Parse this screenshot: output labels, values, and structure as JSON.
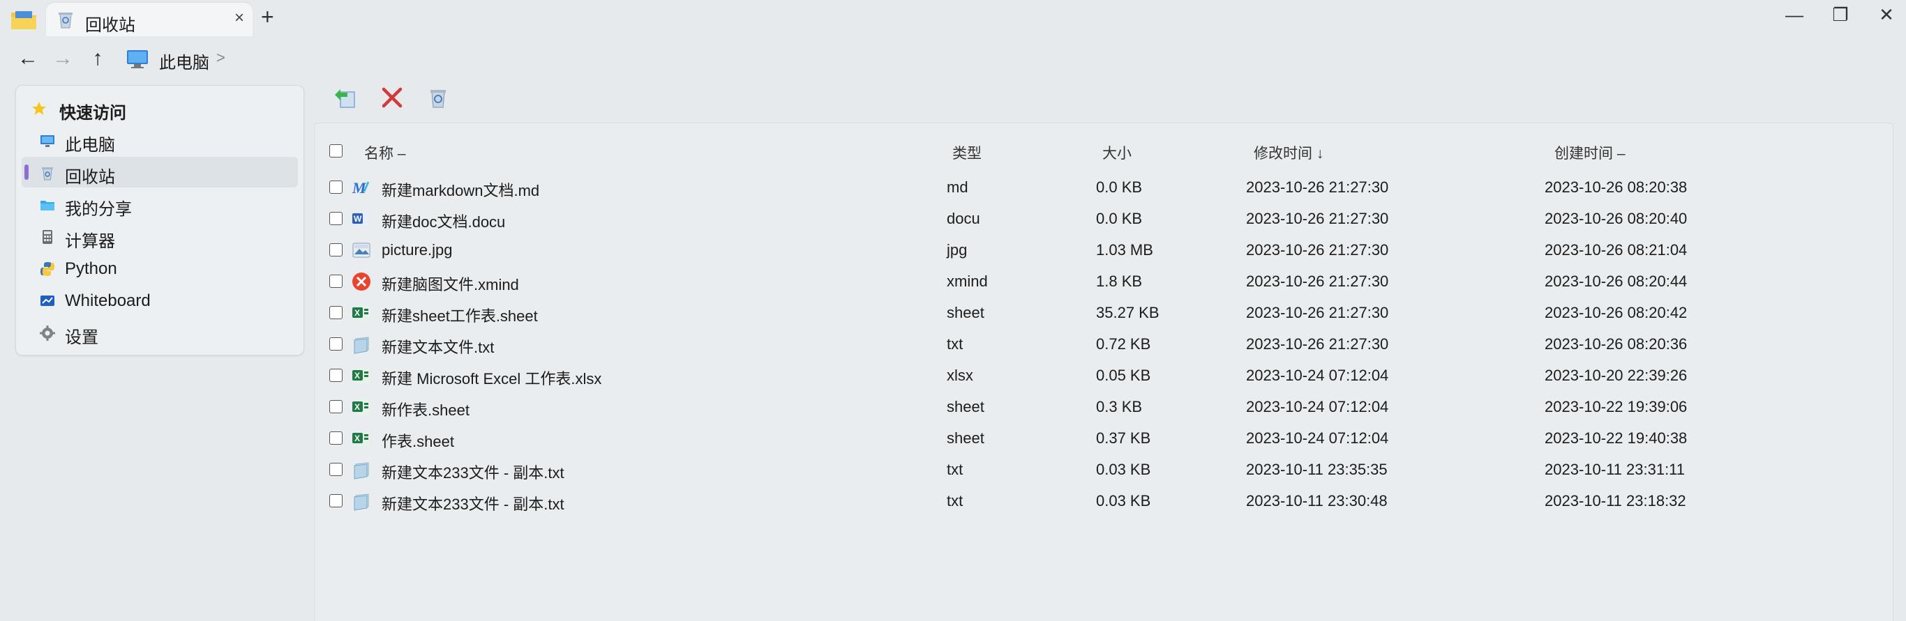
{
  "window": {
    "tab_title": "回收站",
    "new_tab": "+",
    "tab_close": "×",
    "minimize": "—",
    "restore": "❐",
    "close": "✕"
  },
  "nav": {
    "back": "←",
    "forward": "→",
    "up": "↑",
    "breadcrumb": [
      "此电脑"
    ],
    "separator": ">"
  },
  "sidebar": {
    "header": "快速访问",
    "items": [
      {
        "label": "此电脑",
        "icon": "computer-icon",
        "active": false
      },
      {
        "label": "回收站",
        "icon": "recycle-bin-icon",
        "active": true
      },
      {
        "label": "我的分享",
        "icon": "share-folder-icon",
        "active": false
      },
      {
        "label": "计算器",
        "icon": "calculator-icon",
        "active": false
      },
      {
        "label": "Python",
        "icon": "python-icon",
        "active": false
      },
      {
        "label": "Whiteboard",
        "icon": "whiteboard-icon",
        "active": false
      },
      {
        "label": "设置",
        "icon": "gear-icon",
        "active": false
      }
    ]
  },
  "toolbar": {
    "buttons": [
      "restore-icon",
      "delete-icon",
      "empty-bin-icon"
    ]
  },
  "table": {
    "columns": [
      "名称 –",
      "类型",
      "大小",
      "修改时间 ↓",
      "创建时间 –"
    ],
    "rows": [
      {
        "name": "新建markdown文档.md",
        "type": "md",
        "size": "0.0 KB",
        "modified": "2023-10-26 21:27:30",
        "created": "2023-10-26 08:20:38",
        "icon": "markdown-icon"
      },
      {
        "name": "新建doc文档.docu",
        "type": "docu",
        "size": "0.0 KB",
        "modified": "2023-10-26 21:27:30",
        "created": "2023-10-26 08:20:40",
        "icon": "word-icon"
      },
      {
        "name": "picture.jpg",
        "type": "jpg",
        "size": "1.03 MB",
        "modified": "2023-10-26 21:27:30",
        "created": "2023-10-26 08:21:04",
        "icon": "image-icon"
      },
      {
        "name": "新建脑图文件.xmind",
        "type": "xmind",
        "size": "1.8 KB",
        "modified": "2023-10-26 21:27:30",
        "created": "2023-10-26 08:20:44",
        "icon": "xmind-icon"
      },
      {
        "name": "新建sheet工作表.sheet",
        "type": "sheet",
        "size": "35.27 KB",
        "modified": "2023-10-26 21:27:30",
        "created": "2023-10-26 08:20:42",
        "icon": "excel-icon"
      },
      {
        "name": "新建文本文件.txt",
        "type": "txt",
        "size": "0.72 KB",
        "modified": "2023-10-26 21:27:30",
        "created": "2023-10-26 08:20:36",
        "icon": "text-file-icon"
      },
      {
        "name": "新建 Microsoft Excel 工作表.xlsx",
        "type": "xlsx",
        "size": "0.05 KB",
        "modified": "2023-10-24 07:12:04",
        "created": "2023-10-20 22:39:26",
        "icon": "excel-icon"
      },
      {
        "name": "新作表.sheet",
        "type": "sheet",
        "size": "0.3 KB",
        "modified": "2023-10-24 07:12:04",
        "created": "2023-10-22 19:39:06",
        "icon": "excel-icon"
      },
      {
        "name": "作表.sheet",
        "type": "sheet",
        "size": "0.37 KB",
        "modified": "2023-10-24 07:12:04",
        "created": "2023-10-22 19:40:38",
        "icon": "excel-icon"
      },
      {
        "name": "新建文本233文件 - 副本.txt",
        "type": "txt",
        "size": "0.03 KB",
        "modified": "2023-10-11 23:35:35",
        "created": "2023-10-11 23:31:11",
        "icon": "text-file-icon"
      },
      {
        "name": "新建文本233文件 - 副本.txt",
        "type": "txt",
        "size": "0.03 KB",
        "modified": "2023-10-11 23:30:48",
        "created": "2023-10-11 23:18:32",
        "icon": "text-file-icon"
      }
    ]
  },
  "colors": {
    "accent": "#8c6fd1",
    "delete": "#d23a3a",
    "excel": "#1f7a45",
    "word": "#2b5fb8",
    "xmind": "#e8452f",
    "folder": "#f4c542"
  }
}
